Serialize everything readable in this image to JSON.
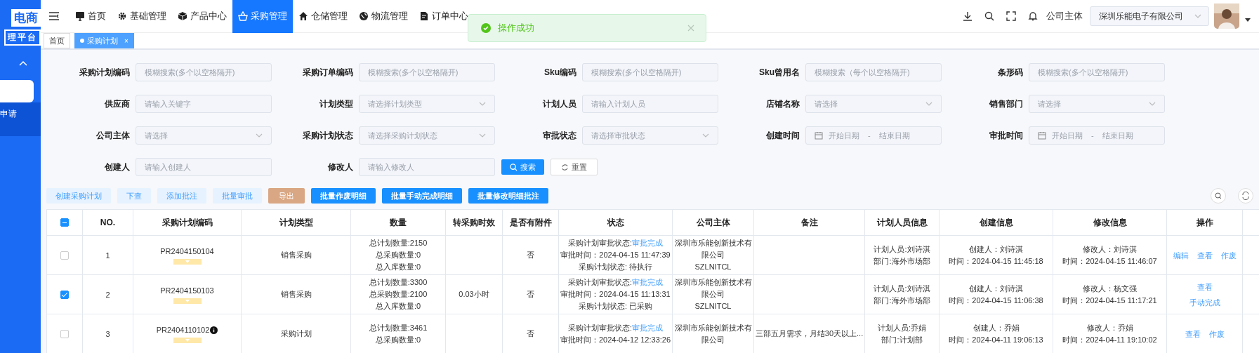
{
  "sidebar": {
    "logo_top": "电商",
    "logo_bottom": "理平台",
    "items": [
      {
        "selected": true
      },
      {
        "label": "申请",
        "selected": false
      }
    ]
  },
  "nav": [
    {
      "label": "首页",
      "selected": false
    },
    {
      "label": "基础管理",
      "selected": false
    },
    {
      "label": "产品中心",
      "selected": false
    },
    {
      "label": "采购管理",
      "selected": true
    },
    {
      "label": "仓储管理",
      "selected": false
    },
    {
      "label": "物流管理",
      "selected": false
    },
    {
      "label": "订单中心",
      "selected": false
    }
  ],
  "header": {
    "company_label": "公司主体",
    "company_select": "深圳乐能电子有限公司"
  },
  "tabs": [
    {
      "label": "首页",
      "selected": false
    },
    {
      "label": "采购计划",
      "selected": true,
      "close": "×"
    }
  ],
  "toast": {
    "kind": "success",
    "message": "操作成功"
  },
  "filters": [
    {
      "label": "采购计划编码",
      "kind": "text",
      "placeholder": "模糊搜索(多个以空格隔开)"
    },
    {
      "label": "采购订单编码",
      "kind": "text",
      "placeholder": "模糊搜索(多个以空格隔开)"
    },
    {
      "label": "Sku编码",
      "kind": "text",
      "placeholder": "模糊搜索(多个以空格隔开)"
    },
    {
      "label": "Sku曾用名",
      "kind": "text",
      "placeholder": "模糊搜索（每个以空格隔开)"
    },
    {
      "label": "条形码",
      "kind": "text",
      "placeholder": "模糊搜索(多个以空格隔开)"
    },
    {
      "label": "供应商",
      "kind": "text",
      "placeholder": "请输入关键字"
    },
    {
      "label": "计划类型",
      "kind": "select",
      "placeholder": "请选择计划类型"
    },
    {
      "label": "计划人员",
      "kind": "text",
      "placeholder": "请输入计划人员"
    },
    {
      "label": "店铺名称",
      "kind": "select",
      "placeholder": "请选择"
    },
    {
      "label": "销售部门",
      "kind": "select",
      "placeholder": "请选择"
    },
    {
      "label": "公司主体",
      "kind": "select",
      "placeholder": "请选择"
    },
    {
      "label": "采购计划状态",
      "kind": "select",
      "placeholder": "请选择采购计划状态"
    },
    {
      "label": "审批状态",
      "kind": "select",
      "placeholder": "请选择审批状态"
    },
    {
      "label": "创建时间",
      "kind": "date",
      "placeholder_start": "开始日期",
      "separator": "-",
      "placeholder_end": "结束日期"
    },
    {
      "label": "审批时间",
      "kind": "date",
      "placeholder_start": "开始日期",
      "separator": "-",
      "placeholder_end": "结束日期"
    },
    {
      "label": "创建人",
      "kind": "text",
      "placeholder": "请输入创建人"
    },
    {
      "label": "修改人",
      "kind": "text",
      "placeholder": "请输入修改人"
    }
  ],
  "search_button": "搜索",
  "reset_button": "重置",
  "actions": [
    {
      "label": "创建采购计划",
      "kind": "light"
    },
    {
      "label": "下查",
      "kind": "light"
    },
    {
      "label": "添加批注",
      "kind": "light"
    },
    {
      "label": "批量审批",
      "kind": "light"
    },
    {
      "label": "导出",
      "kind": "warning"
    },
    {
      "label": "批量作废明细",
      "kind": "primary"
    },
    {
      "label": "批量手动完成明细",
      "kind": "primary"
    },
    {
      "label": "批量修改明细批注",
      "kind": "primary"
    }
  ],
  "table": {
    "header_indeterminate": true,
    "columns": [
      "NO.",
      "采购计划编码",
      "计划类型",
      "数量",
      "转采购时效",
      "是否有附件",
      "状态",
      "公司主体",
      "备注",
      "计划人员信息",
      "创建信息",
      "修改信息",
      "操作"
    ],
    "rows": [
      {
        "checked": false,
        "no": "1",
        "code": "PR2404150104",
        "info": false,
        "type": "销售采购",
        "quantity": [
          "总计划数量:2150",
          "总采购数量:0",
          "总入库数量:0"
        ],
        "attachment": "否",
        "status": {
          "approval_label": "采购计划审批状态:",
          "approval": "审批完成",
          "lines": [
            "审批时间：2024-04-15 11:47:39",
            "采购计划状态: 待执行"
          ]
        },
        "company": [
          "深圳市乐能创新技术有",
          "限公司",
          "SZLNITCL"
        ],
        "planner": [
          "计划人员:刘诗淇",
          "部门:海外市场部"
        ],
        "created": [
          "创建人：刘诗淇",
          "时间：2024-04-15 11:45:18"
        ],
        "modified": [
          "修改人：刘诗淇",
          "时间：2024-04-15 11:46:07"
        ],
        "operations": [
          [
            "编辑",
            "查看",
            "作废"
          ]
        ]
      },
      {
        "checked": true,
        "no": "2",
        "code": "PR2404150103",
        "info": false,
        "type": "销售采购",
        "quantity": [
          "总计划数量:3300",
          "总采购数量:2100",
          "总入库数量:0"
        ],
        "timeliness": "0.03小时",
        "attachment": "否",
        "status": {
          "approval_label": "采购计划审批状态:",
          "approval": "审批完成",
          "lines": [
            "审批时间：2024-04-15 11:13:31",
            "采购计划状态: 已采购"
          ]
        },
        "company": [
          "深圳市乐能创新技术有",
          "限公司",
          "SZLNITCL"
        ],
        "planner": [
          "计划人员:刘诗淇",
          "部门:海外市场部"
        ],
        "created": [
          "创建人：刘诗淇",
          "时间：2024-04-15 11:06:38"
        ],
        "modified": [
          "修改人：杨文强",
          "时间：2024-04-15 11:17:21"
        ],
        "operations": [
          [
            "查看"
          ],
          [
            "手动完成"
          ]
        ]
      },
      {
        "checked": false,
        "no": "3",
        "code": "PR2404110102",
        "info": true,
        "type": "采购计划",
        "quantity": [
          "总计划数量:3461",
          "总采购数量:0"
        ],
        "attachment": "否",
        "status": {
          "approval_label": "采购计划审批状态:",
          "approval": "审批完成",
          "lines": [
            "审批时间：2024-04-12 12:33:26"
          ]
        },
        "company": [
          "深圳市乐能创新技术有",
          "限公司"
        ],
        "note": "三部五月需求，月结30天以上...",
        "planner": [
          "计划人员:乔娟",
          "部门:计划部"
        ],
        "created": [
          "创建人：乔娟",
          "时间：2024-04-11 19:06:13"
        ],
        "modified": [
          "修改人：乔娟",
          "时间：2024-04-11 19:10:02"
        ],
        "operations": [
          [
            "查看",
            "作废"
          ]
        ]
      }
    ]
  }
}
